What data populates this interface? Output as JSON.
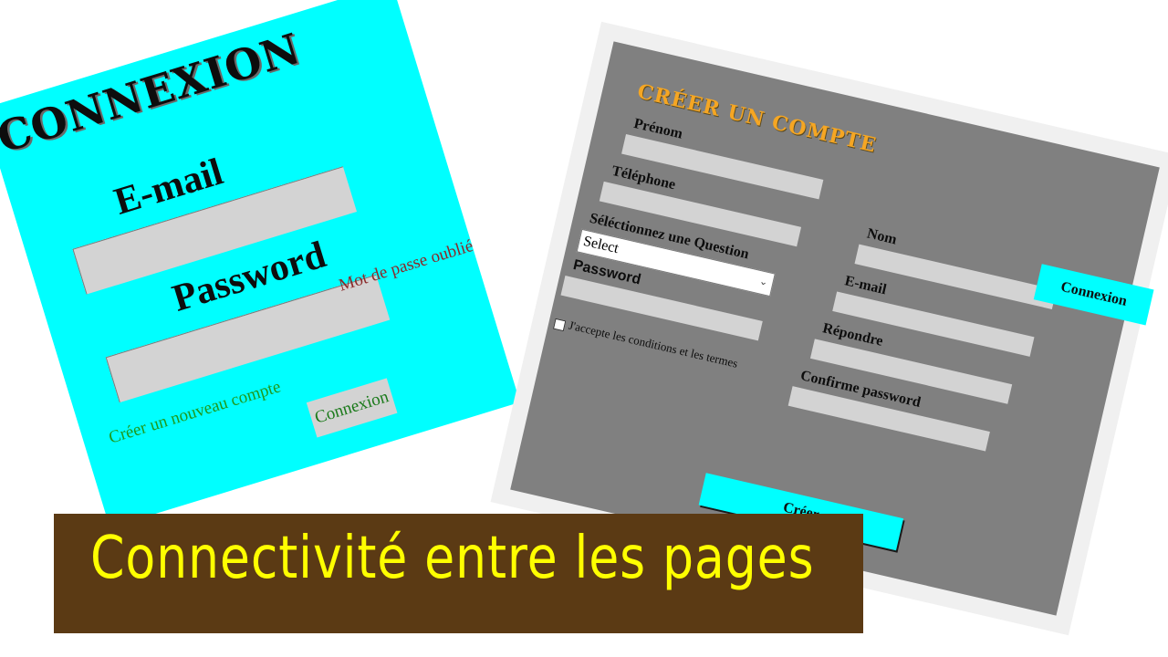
{
  "login": {
    "title": "CONNEXION",
    "email_label": "E-mail",
    "password_label": "Password",
    "forgot_link": "Mot de passe oublié",
    "create_link": "Créer un nouveau compte",
    "submit_label": "Connexion"
  },
  "signup": {
    "title": "CRÉER UN COMPTE",
    "left_fields": {
      "prenom": "Prénom",
      "telephone": "Téléphone",
      "question": "Séléctionnez une Question",
      "password": "Password"
    },
    "right_fields": {
      "nom": "Nom",
      "email": "E-mail",
      "repondre": "Répondre",
      "confirm_password": "Confirme password"
    },
    "question_select_value": "Select",
    "terms_label": "J'accepte les conditions et les termes",
    "connexion_button": "Connexion",
    "submit_label": "Créer"
  },
  "banner": {
    "text": "Connectivité entre les pages"
  },
  "colors": {
    "login_bg": "#00ffff",
    "signup_bg": "#808080",
    "signup_title": "#f5a623",
    "banner_bg": "#5b3a14",
    "banner_text": "#ffff00"
  }
}
